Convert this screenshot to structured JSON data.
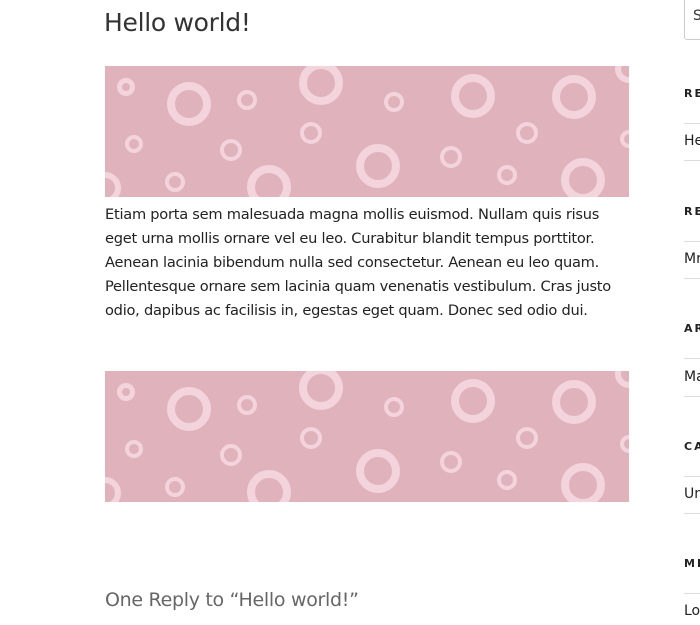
{
  "post": {
    "meta_fragment": "—,",
    "title": "Hello world!",
    "body": "Etiam porta sem malesuada magna mollis euismod. Nullam quis risus eget urna mollis ornare vel eu leo. Curabitur blandit tempus porttitor. Aenean lacinia bibendum nulla sed consectetur. Aenean eu leo quam. Pellentesque ornare sem lacinia quam venenatis vestibulum. Cras justo odio, dapibus ac facilisis in, egestas eget quam. Donec sed odio dui."
  },
  "images": [
    {
      "name": "pattern-image-1",
      "background": "#e0b3bc",
      "dots": "#f3d3dc"
    },
    {
      "name": "pattern-image-2",
      "background": "#e0b3bc",
      "dots": "#f3d3dc"
    }
  ],
  "comments": {
    "title": "One Reply to “Hello world!”"
  },
  "sidebar": {
    "search_visible_char": "S",
    "widgets": [
      {
        "title": "RE",
        "item": "He"
      },
      {
        "title": "RE",
        "item": "Mr"
      },
      {
        "title": "AR",
        "item": "Ma"
      },
      {
        "title": "CA",
        "item": "Un"
      },
      {
        "title": "ME",
        "item": "Lo"
      }
    ]
  }
}
